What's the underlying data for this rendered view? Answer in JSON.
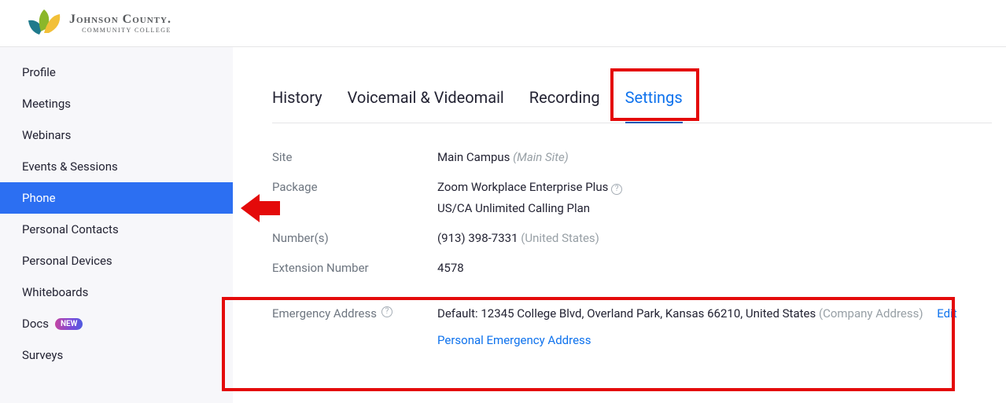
{
  "header": {
    "logo_main": "Johnson County.",
    "logo_sub": "COMMUNITY COLLEGE"
  },
  "sidebar": {
    "items": [
      {
        "label": "Profile"
      },
      {
        "label": "Meetings"
      },
      {
        "label": "Webinars"
      },
      {
        "label": "Events & Sessions"
      },
      {
        "label": "Phone",
        "active": true
      },
      {
        "label": "Personal Contacts"
      },
      {
        "label": "Personal Devices"
      },
      {
        "label": "Whiteboards"
      },
      {
        "label": "Docs",
        "badge": "NEW"
      },
      {
        "label": "Surveys"
      }
    ]
  },
  "tabs": [
    {
      "label": "History"
    },
    {
      "label": "Voicemail & Videomail"
    },
    {
      "label": "Recording"
    },
    {
      "label": "Settings",
      "active": true
    }
  ],
  "fields": {
    "site_label": "Site",
    "site_value": "Main Campus",
    "site_note": "(Main Site)",
    "package_label": "Package",
    "package_line1": "Zoom Workplace Enterprise Plus",
    "package_line2": "US/CA Unlimited Calling Plan",
    "numbers_label": "Number(s)",
    "numbers_value": "(913) 398-7331",
    "numbers_note": "(United States)",
    "extension_label": "Extension Number",
    "extension_value": "4578",
    "emergency_label": "Emergency Address",
    "emergency_prefix": "Default: ",
    "emergency_value": "12345 College Blvd, Overland Park, Kansas 66210, United States",
    "emergency_note": "(Company Address)",
    "edit": "Edit",
    "personal_emerg": "Personal Emergency Address"
  }
}
